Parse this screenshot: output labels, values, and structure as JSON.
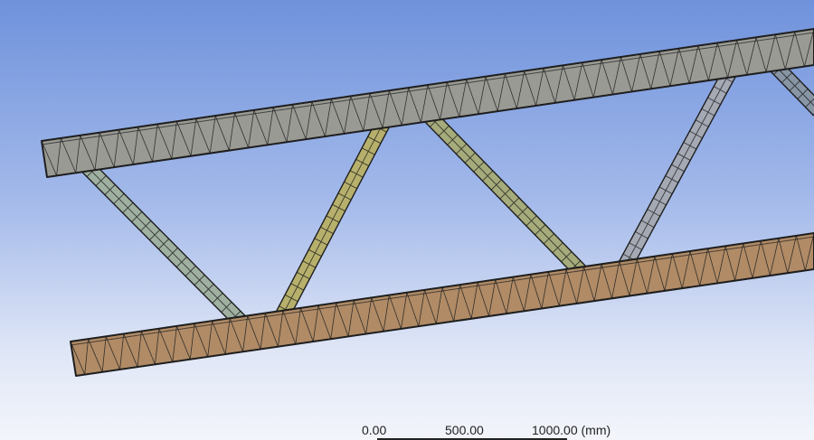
{
  "scale_bar": {
    "labels": [
      "0.00",
      "500.00",
      "1000.00 (mm)"
    ]
  },
  "colors": {
    "top_chord": "#9a9a94",
    "bottom_chord": "#b08b66",
    "diagonal_1": "#9fb0a1",
    "diagonal_2": "#b7b06c",
    "diagonal_3": "#a5ab7a",
    "diagonal_4": "#a4a9b4",
    "diagonal_5": "#8795a4",
    "mesh_edge": "#1e1e1e"
  }
}
